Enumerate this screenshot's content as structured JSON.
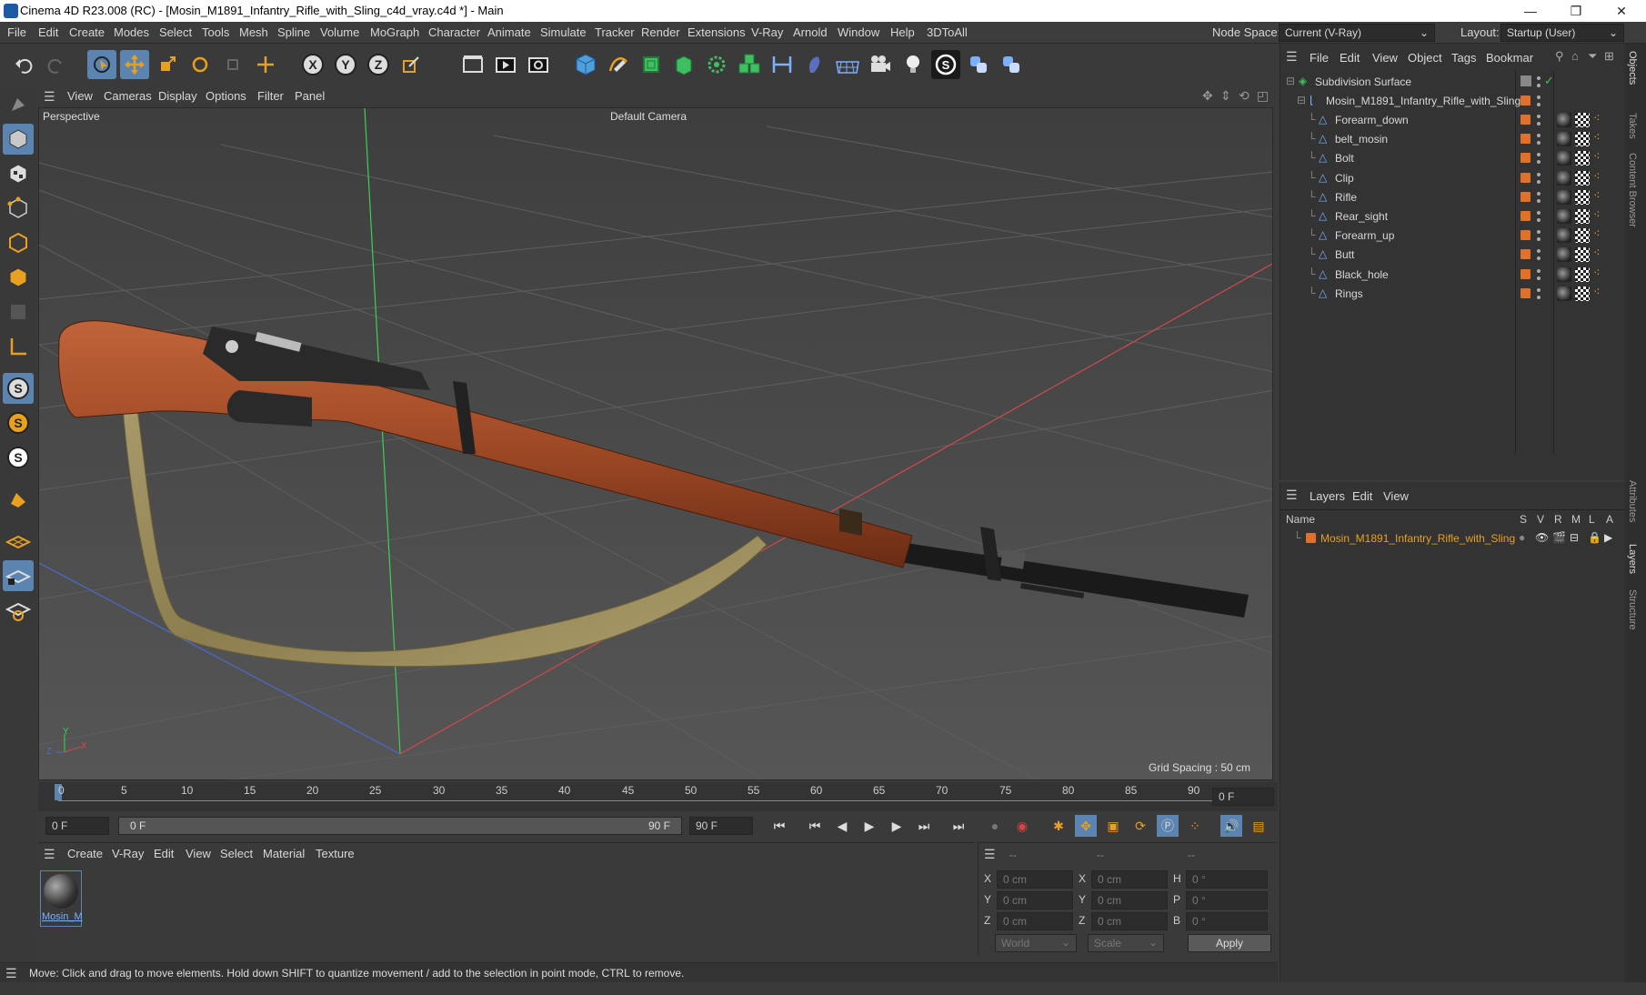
{
  "window": {
    "title": "Cinema 4D R23.008 (RC) - [Mosin_M1891_Infantry_Rifle_with_Sling_c4d_vray.c4d *] - Main",
    "minimize": "—",
    "maximize": "❐",
    "close": "✕"
  },
  "menu": [
    "File",
    "Edit",
    "Create",
    "Modes",
    "Select",
    "Tools",
    "Mesh",
    "Spline",
    "Volume",
    "MoGraph",
    "Character",
    "Animate",
    "Simulate",
    "Tracker",
    "Render",
    "Extensions",
    "V-Ray",
    "Arnold",
    "Window",
    "Help",
    "3DToAll"
  ],
  "node_space": {
    "label": "Node Space:",
    "value": "Current (V-Ray)"
  },
  "layout": {
    "label": "Layout:",
    "value": "Startup (User)"
  },
  "viewport": {
    "menu": [
      "View",
      "Cameras",
      "Display",
      "Options",
      "Filter",
      "Panel"
    ],
    "label": "Perspective",
    "camera": "Default Camera",
    "grid_spacing": "Grid Spacing : 50 cm",
    "axis_labels": {
      "y": "Y",
      "z": "Z",
      "x": "X"
    }
  },
  "timeline": {
    "ticks": [
      "0",
      "5",
      "10",
      "15",
      "20",
      "25",
      "30",
      "35",
      "40",
      "45",
      "50",
      "55",
      "60",
      "65",
      "70",
      "75",
      "80",
      "85",
      "90"
    ],
    "current_frame": "0 F",
    "start": "0 F",
    "range_start": "0 F",
    "range_end": "90 F",
    "end": "90 F"
  },
  "material_panel": {
    "menu": [
      "Create",
      "V-Ray",
      "Edit",
      "View",
      "Select",
      "Material",
      "Texture"
    ],
    "material_name": "Mosin_M"
  },
  "coords": {
    "rows": [
      {
        "axis": "X",
        "pos": "0 cm",
        "axis2": "X",
        "size": "0 cm",
        "axis3": "H",
        "rot": "0 °"
      },
      {
        "axis": "Y",
        "pos": "0 cm",
        "axis2": "Y",
        "size": "0 cm",
        "axis3": "P",
        "rot": "0 °"
      },
      {
        "axis": "Z",
        "pos": "0 cm",
        "axis2": "Z",
        "size": "0 cm",
        "axis3": "B",
        "rot": "0 °"
      }
    ],
    "header1": "--",
    "header2": "--",
    "header3": "--",
    "mode": "World",
    "size_mode": "Scale",
    "apply": "Apply"
  },
  "status": "Move: Click and drag to move elements. Hold down SHIFT to quantize movement / add to the selection in point mode, CTRL to remove.",
  "objects": {
    "menu": [
      "File",
      "Edit",
      "View",
      "Object",
      "Tags",
      "Bookmar"
    ],
    "root": "Subdivision Surface",
    "group": "Mosin_M1891_Infantry_Rifle_with_Sling",
    "children": [
      "Forearm_down",
      "belt_mosin",
      "Bolt",
      "Clip",
      "Rifle",
      "Rear_sight",
      "Forearm_up",
      "Butt",
      "Black_hole",
      "Rings"
    ]
  },
  "layers": {
    "menu": [
      "Layers",
      "Edit",
      "View"
    ],
    "columns": {
      "name": "Name",
      "s": "S",
      "v": "V",
      "r": "R",
      "m": "M",
      "l": "L",
      "a": "A"
    },
    "items": [
      "Mosin_M1891_Infantry_Rifle_with_Sling"
    ]
  },
  "side_tabs": [
    "Objects",
    "Takes",
    "Content Browser",
    "Attributes",
    "Layers",
    "Structure"
  ],
  "colors": {
    "accent": "#5c84b0",
    "layer_orange": "#e0702a",
    "viewport_bg": "#4b4b4b"
  }
}
